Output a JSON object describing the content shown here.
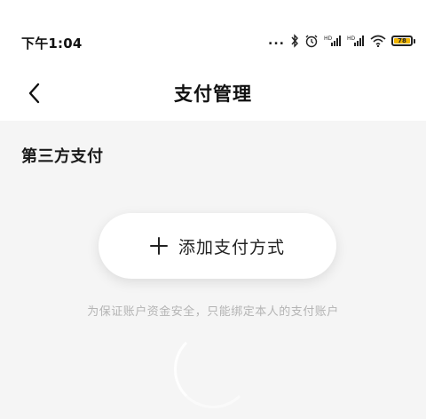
{
  "status_bar": {
    "time": "下午1:04",
    "more_dots": "...",
    "battery_level": "78",
    "icons": [
      "bluetooth-icon",
      "alarm-icon",
      "signal-hd-1-icon",
      "signal-hd-2-icon",
      "wifi-icon",
      "battery-icon"
    ]
  },
  "header": {
    "title": "支付管理",
    "back_icon": "chevron-left-icon"
  },
  "section": {
    "title": "第三方支付"
  },
  "add_payment": {
    "icon": "plus-icon",
    "label": "添加支付方式"
  },
  "hint": "为保证账户资金安全，只能绑定本人的支付账户",
  "colors": {
    "page_background": "#f5f5f5",
    "surface": "#ffffff",
    "text_primary": "#222222",
    "text_hint": "#b4b4b4",
    "battery_fill": "#f0b400"
  }
}
